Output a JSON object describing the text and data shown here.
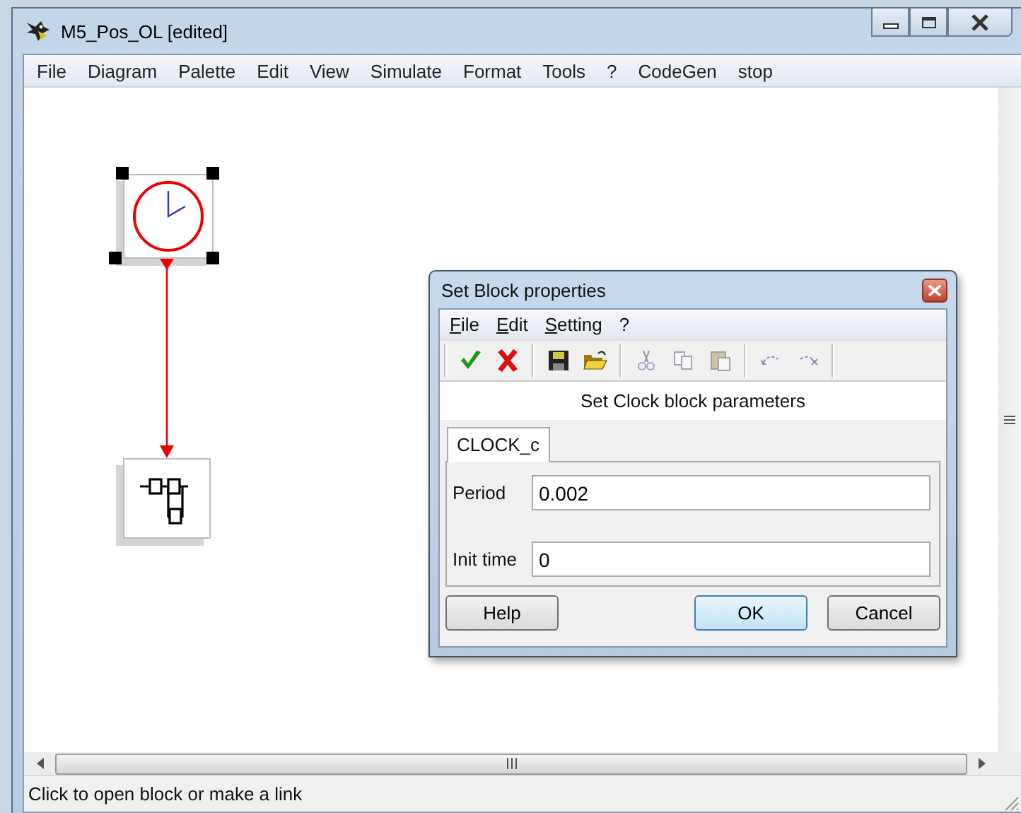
{
  "window": {
    "title": "M5_Pos_OL [edited]"
  },
  "menu": [
    "File",
    "Diagram",
    "Palette",
    "Edit",
    "View",
    "Simulate",
    "Format",
    "Tools",
    "?",
    "CodeGen",
    "stop"
  ],
  "canvas": {
    "blocks": [
      {
        "kind": "clock",
        "selected": true
      },
      {
        "kind": "split",
        "selected": false
      }
    ]
  },
  "dialog": {
    "title": "Set Block properties",
    "menu": [
      "File",
      "Edit",
      "Setting",
      "?"
    ],
    "toolbar": [
      {
        "kind": "accept",
        "disabled": false
      },
      {
        "kind": "cancel",
        "disabled": false
      },
      {
        "kind": "save",
        "disabled": false
      },
      {
        "kind": "open",
        "disabled": false
      },
      {
        "kind": "cut",
        "disabled": true
      },
      {
        "kind": "copy",
        "disabled": true
      },
      {
        "kind": "paste",
        "disabled": true
      },
      {
        "kind": "undo",
        "disabled": true
      },
      {
        "kind": "redo",
        "disabled": true
      }
    ],
    "heading": "Set Clock block parameters",
    "tabs": [
      {
        "label": "CLOCK_c",
        "selected": true
      }
    ],
    "fields": [
      {
        "label": "Period",
        "value": "0.002"
      },
      {
        "label": "Init time",
        "value": "0"
      }
    ],
    "buttons": [
      {
        "label": "Help",
        "default": false
      },
      {
        "label": "OK",
        "default": true
      },
      {
        "label": "Cancel",
        "default": false
      }
    ]
  },
  "status_bar": "Click to open block or make a link"
}
